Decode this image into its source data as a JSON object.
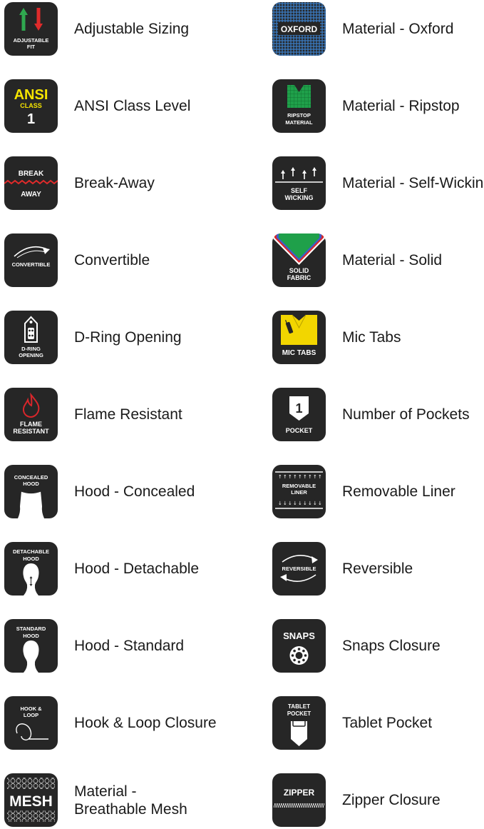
{
  "features": {
    "left": [
      {
        "label": "Adjustable Sizing",
        "icon": "adjustable-fit-icon",
        "icon_text": [
          "ADJUSTABLE",
          "FIT"
        ]
      },
      {
        "label": "ANSI Class Level",
        "icon": "ansi-class-icon",
        "icon_text": [
          "ANSI",
          "CLASS",
          "1"
        ]
      },
      {
        "label": "Break-Away",
        "icon": "break-away-icon",
        "icon_text": [
          "BREAK",
          "AWAY"
        ]
      },
      {
        "label": "Convertible",
        "icon": "convertible-icon",
        "icon_text": [
          "CONVERTIBLE"
        ]
      },
      {
        "label": "D-Ring Opening",
        "icon": "d-ring-opening-icon",
        "icon_text": [
          "D-RING",
          "OPENING"
        ]
      },
      {
        "label": "Flame Resistant",
        "icon": "flame-resistant-icon",
        "icon_text": [
          "FLAME",
          "RESISTANT"
        ]
      },
      {
        "label": "Hood - Concealed",
        "icon": "concealed-hood-icon",
        "icon_text": [
          "CONCEALED",
          "HOOD"
        ]
      },
      {
        "label": "Hood - Detachable",
        "icon": "detachable-hood-icon",
        "icon_text": [
          "DETACHABLE",
          "HOOD"
        ]
      },
      {
        "label": "Hood - Standard",
        "icon": "standard-hood-icon",
        "icon_text": [
          "STANDARD",
          "HOOD"
        ]
      },
      {
        "label": "Hook & Loop Closure",
        "icon": "hook-and-loop-icon",
        "icon_text": [
          "HOOK &",
          "LOOP"
        ]
      },
      {
        "label_lines": [
          "Material -",
          "Breathable Mesh"
        ],
        "icon": "mesh-icon",
        "icon_text": [
          "MESH"
        ]
      }
    ],
    "right": [
      {
        "label": "Material - Oxford",
        "icon": "oxford-icon",
        "icon_text": [
          "OXFORD"
        ]
      },
      {
        "label": "Material - Ripstop",
        "icon": "ripstop-icon",
        "icon_text": [
          "RIPSTOP",
          "MATERIAL"
        ]
      },
      {
        "label": "Material - Self-Wicking",
        "icon": "self-wicking-icon",
        "icon_text": [
          "SELF",
          "WICKING"
        ]
      },
      {
        "label": "Material - Solid",
        "icon": "solid-fabric-icon",
        "icon_text": [
          "SOLID",
          "FABRIC"
        ]
      },
      {
        "label": "Mic Tabs",
        "icon": "mic-tabs-icon",
        "icon_text": [
          "MIC TABS"
        ]
      },
      {
        "label": "Number of Pockets",
        "icon": "pocket-count-icon",
        "icon_text": [
          "1",
          "POCKET"
        ]
      },
      {
        "label": "Removable Liner",
        "icon": "removable-liner-icon",
        "icon_text": [
          "REMOVABLE",
          "LINER"
        ]
      },
      {
        "label": "Reversible",
        "icon": "reversible-icon",
        "icon_text": [
          "REVERSIBLE"
        ]
      },
      {
        "label": "Snaps Closure",
        "icon": "snaps-icon",
        "icon_text": [
          "SNAPS"
        ]
      },
      {
        "label": "Tablet Pocket",
        "icon": "tablet-pocket-icon",
        "icon_text": [
          "TABLET",
          "POCKET"
        ]
      },
      {
        "label": "Zipper Closure",
        "icon": "zipper-icon",
        "icon_text": [
          "ZIPPER"
        ]
      }
    ]
  },
  "colors": {
    "icon_bg": "#262626",
    "arrow_up": "#2fa84f",
    "arrow_down": "#e02b2b",
    "ansi_yellow": "#f5e400",
    "breakaway_red": "#e02b2b",
    "oxford_blue": "#3b7ec8",
    "ripstop_green": "#1fa04a",
    "mic_yellow": "#f2d600",
    "flame_red": "#d9262b"
  }
}
